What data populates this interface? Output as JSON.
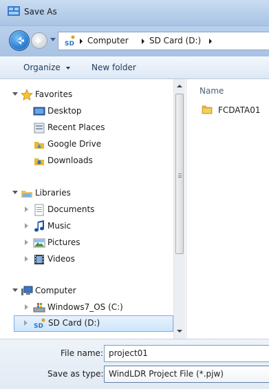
{
  "window": {
    "title": "Save As"
  },
  "address": {
    "segments": [
      "Computer",
      "SD Card (D:)"
    ]
  },
  "toolbar": {
    "organize_label": "Organize",
    "new_folder_label": "New folder"
  },
  "nav": {
    "favorites": {
      "label": "Favorites",
      "items": [
        "Desktop",
        "Recent Places",
        "Google Drive",
        "Downloads"
      ]
    },
    "libraries": {
      "label": "Libraries",
      "items": [
        "Documents",
        "Music",
        "Pictures",
        "Videos"
      ]
    },
    "computer": {
      "label": "Computer",
      "items": [
        "Windows7_OS (C:)",
        "SD Card (D:)"
      ],
      "selected_item": "SD Card (D:)"
    }
  },
  "content": {
    "column_header": "Name",
    "files": [
      "FCDATA01"
    ]
  },
  "fields": {
    "file_name_label": "File name:",
    "file_name_value": "project01",
    "save_as_type_label": "Save as type:",
    "save_as_type_value": "WindLDR Project File (*.pjw)"
  },
  "colors": {
    "titlebar": "#b5cde9",
    "selection": "#cde6fb",
    "toolbar_text": "#1e395b"
  },
  "icons": {
    "title": "save-as-icon",
    "back": "back-arrow-icon",
    "forward": "forward-arrow-icon",
    "sd_card": "sd-card-icon",
    "folder": "folder-icon"
  }
}
